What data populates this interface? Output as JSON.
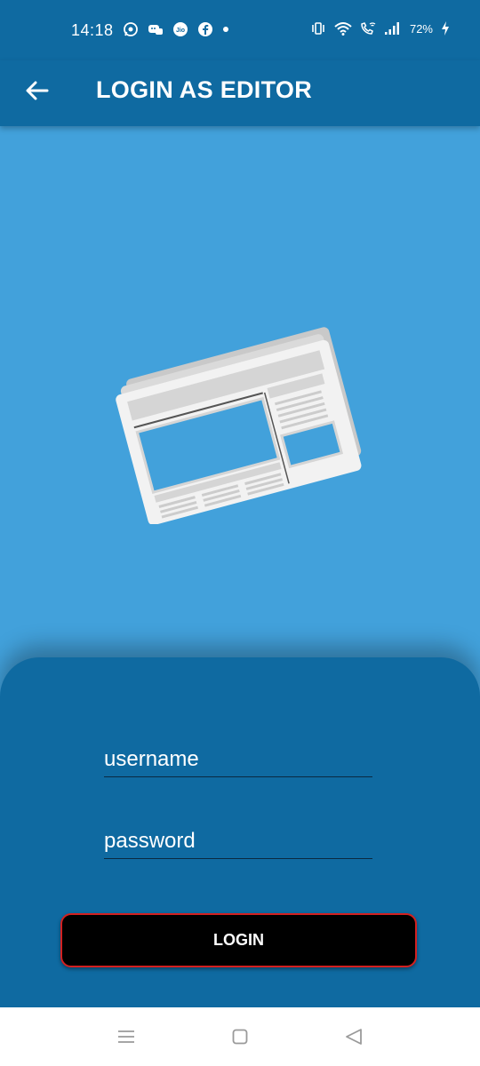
{
  "status_bar": {
    "time": "14:18",
    "battery": "72%",
    "left_icons": [
      "whatsapp-icon",
      "messenger-icon",
      "jio-icon",
      "facebook-icon",
      "dot-icon"
    ],
    "right_icons": [
      "vibrate-icon",
      "wifi-icon",
      "wifi-call-icon",
      "signal-icon",
      "battery-charging-icon"
    ]
  },
  "app_bar": {
    "title": "LOGIN AS EDITOR",
    "back_icon": "arrow-left-icon"
  },
  "hero": {
    "illustration": "newspaper-icon"
  },
  "form": {
    "username_placeholder": "username",
    "password_placeholder": "password",
    "login_label": "LOGIN"
  },
  "colors": {
    "primary_dark": "#0f6aa1",
    "hero_blue": "#42a1db",
    "button_bg": "#000000",
    "button_border": "#d32020"
  }
}
